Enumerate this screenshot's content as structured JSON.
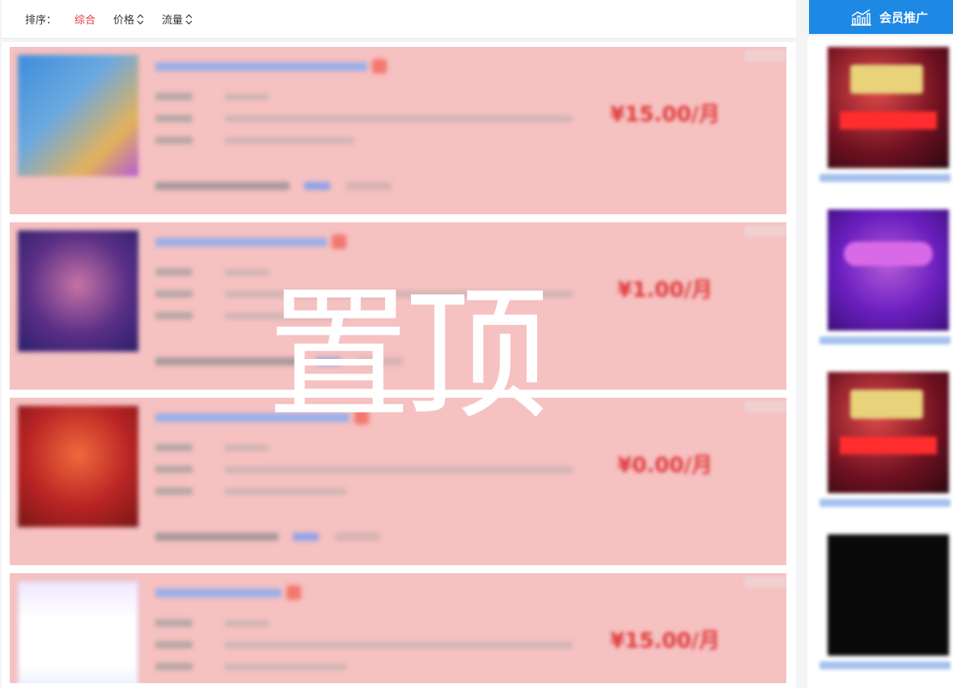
{
  "sort_bar": {
    "label": "排序：",
    "options": [
      {
        "label": "综合",
        "active": true
      },
      {
        "label": "价格",
        "active": false,
        "sortable": true
      },
      {
        "label": "流量",
        "active": false,
        "sortable": true
      }
    ]
  },
  "member_promo": {
    "label": "会员推广",
    "icon": "bar-chart-icon"
  },
  "listings": [
    {
      "price": "¥15.00/月",
      "thumbnail": "blurred-product-image"
    },
    {
      "price": "¥1.00/月",
      "thumbnail": "blurred-product-image"
    },
    {
      "price": "¥0.00/月",
      "thumbnail": "blurred-product-image"
    },
    {
      "price": "¥15.00/月",
      "thumbnail": "blurred-product-image"
    }
  ],
  "overlay": {
    "text": "置顶",
    "highlight_color": "#f6c1c1"
  },
  "sidebar_ads": [
    {
      "image": "blurred-ad-image"
    },
    {
      "image": "blurred-ad-image"
    },
    {
      "image": "blurred-ad-image"
    },
    {
      "image": "blurred-ad-image"
    }
  ],
  "colors": {
    "accent_red": "#e4393c",
    "price_red": "#e03a3a",
    "promo_blue": "#1e88e5"
  }
}
